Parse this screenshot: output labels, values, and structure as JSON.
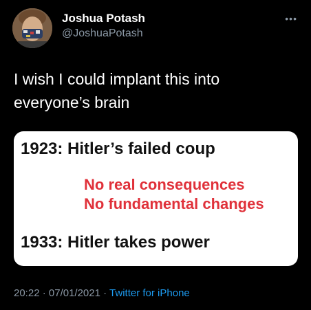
{
  "author": {
    "display_name": "Joshua Potash",
    "handle": "@JoshuaPotash",
    "avatar_icon": "profile-photo-avatar"
  },
  "more_icon": "more-options-icon",
  "tweet": {
    "text": "I wish I could implant this into everyone’s brain"
  },
  "media": {
    "line1": "1923: Hitler’s failed coup",
    "red_line1": "No real consequences",
    "red_line2": "No fundamental changes",
    "line2": "1933: Hitler takes power",
    "red_color": "#e0313a"
  },
  "meta": {
    "time": "20:22",
    "separator": "·",
    "date": "07/01/2021",
    "source": "Twitter for iPhone"
  },
  "colors": {
    "background": "#000000",
    "link": "#1d9bf0",
    "secondary_text": "#8b98a5"
  }
}
